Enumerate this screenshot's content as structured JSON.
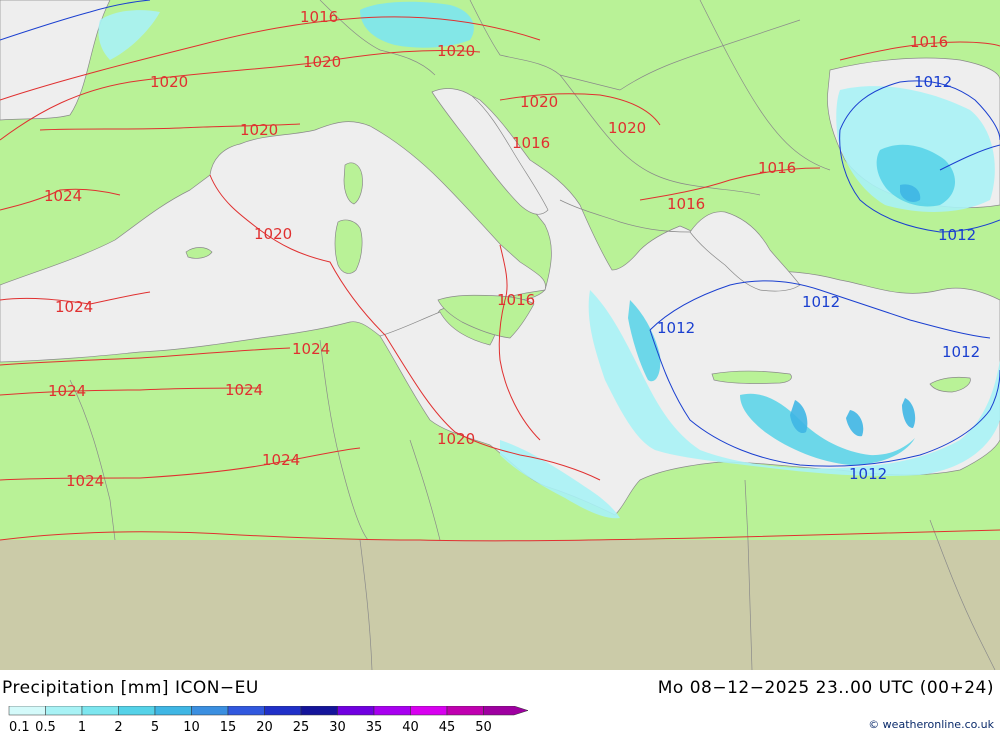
{
  "header": {
    "title": "Precipitation [mm] ICON−EU",
    "datetime": "Mo 08−12−2025 23..00 UTC (00+24)",
    "copyright": "© weatheronline.co.uk"
  },
  "legend": {
    "values": [
      "0.1",
      "0.5",
      "1",
      "2",
      "5",
      "10",
      "15",
      "20",
      "25",
      "30",
      "35",
      "40",
      "45",
      "50"
    ],
    "colors": [
      "#d4fafa",
      "#a8f2f5",
      "#7de6ef",
      "#55d2e8",
      "#3fb6e4",
      "#3b8fe0",
      "#3158de",
      "#2030c8",
      "#14149a",
      "#7000e0",
      "#a800f0",
      "#d800f0",
      "#c000b0",
      "#9e00a0"
    ]
  },
  "colors": {
    "land": "#b9f297",
    "sea": "#eeeeee",
    "outside": "#cbcba8",
    "isobar_high": "#e03030",
    "isobar_low": "#1a3fd0",
    "border": "#8a8a8a"
  },
  "isobar_labels": [
    {
      "text": "1016",
      "color": "red"
    },
    {
      "text": "1020",
      "color": "red"
    },
    {
      "text": "1020",
      "color": "red"
    },
    {
      "text": "1020",
      "color": "red"
    },
    {
      "text": "1020",
      "color": "red"
    },
    {
      "text": "1020",
      "color": "red"
    },
    {
      "text": "1020",
      "color": "red"
    },
    {
      "text": "1016",
      "color": "red"
    },
    {
      "text": "1016",
      "color": "red"
    },
    {
      "text": "1016",
      "color": "red"
    },
    {
      "text": "1016",
      "color": "red"
    },
    {
      "text": "1024",
      "color": "red"
    },
    {
      "text": "1020",
      "color": "red"
    },
    {
      "text": "1016",
      "color": "red"
    },
    {
      "text": "1024",
      "color": "red"
    },
    {
      "text": "1024",
      "color": "red"
    },
    {
      "text": "1024",
      "color": "red"
    },
    {
      "text": "1024",
      "color": "red"
    },
    {
      "text": "1020",
      "color": "red"
    },
    {
      "text": "1024",
      "color": "red"
    },
    {
      "text": "1024",
      "color": "red"
    },
    {
      "text": "1012",
      "color": "blue"
    },
    {
      "text": "1012",
      "color": "blue"
    },
    {
      "text": "1012",
      "color": "blue"
    },
    {
      "text": "1012",
      "color": "blue"
    },
    {
      "text": "1012",
      "color": "blue"
    },
    {
      "text": "1012",
      "color": "blue"
    }
  ]
}
